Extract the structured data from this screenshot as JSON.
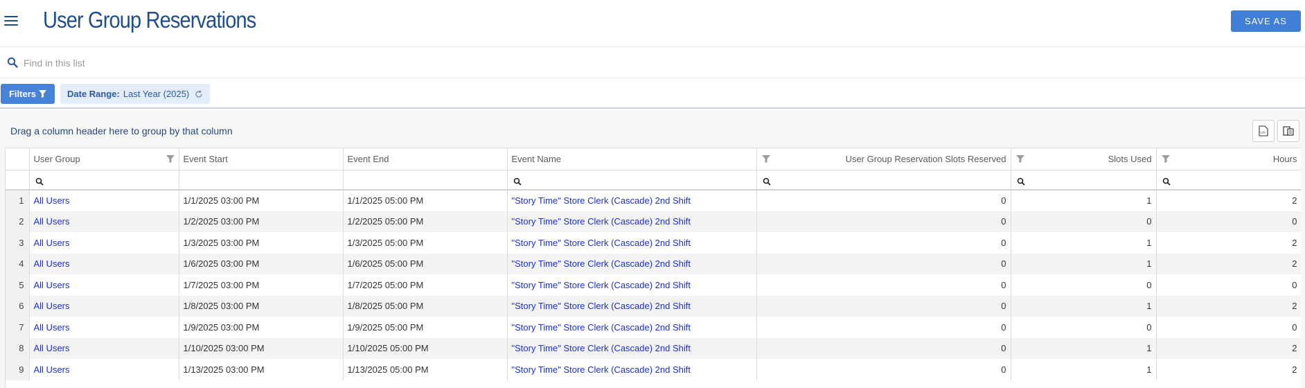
{
  "header": {
    "title": "User Group Reservations",
    "save_as_label": "SAVE AS"
  },
  "search": {
    "placeholder": "Find in this list"
  },
  "filters": {
    "button_label": "Filters",
    "chip_key": "Date Range:",
    "chip_value": "Last Year (2025)"
  },
  "grid": {
    "group_hint": "Drag a column header here to group by that column",
    "columns": [
      "User Group",
      "Event Start",
      "Event End",
      "Event Name",
      "User Group Reservation Slots Reserved",
      "Slots Used",
      "Hours"
    ],
    "rows": [
      {
        "n": "1",
        "user_group": "All Users",
        "start": "1/1/2025 03:00 PM",
        "end": "1/1/2025 05:00 PM",
        "event": "\"Story Time\" Store Clerk (Cascade) 2nd Shift",
        "reserved": "0",
        "used": "1",
        "hours": "2"
      },
      {
        "n": "2",
        "user_group": "All Users",
        "start": "1/2/2025 03:00 PM",
        "end": "1/2/2025 05:00 PM",
        "event": "\"Story Time\" Store Clerk (Cascade) 2nd Shift",
        "reserved": "0",
        "used": "0",
        "hours": "0"
      },
      {
        "n": "3",
        "user_group": "All Users",
        "start": "1/3/2025 03:00 PM",
        "end": "1/3/2025 05:00 PM",
        "event": "\"Story Time\" Store Clerk (Cascade) 2nd Shift",
        "reserved": "0",
        "used": "1",
        "hours": "2"
      },
      {
        "n": "4",
        "user_group": "All Users",
        "start": "1/6/2025 03:00 PM",
        "end": "1/6/2025 05:00 PM",
        "event": "\"Story Time\" Store Clerk (Cascade) 2nd Shift",
        "reserved": "0",
        "used": "1",
        "hours": "2"
      },
      {
        "n": "5",
        "user_group": "All Users",
        "start": "1/7/2025 03:00 PM",
        "end": "1/7/2025 05:00 PM",
        "event": "\"Story Time\" Store Clerk (Cascade) 2nd Shift",
        "reserved": "0",
        "used": "0",
        "hours": "0"
      },
      {
        "n": "6",
        "user_group": "All Users",
        "start": "1/8/2025 03:00 PM",
        "end": "1/8/2025 05:00 PM",
        "event": "\"Story Time\" Store Clerk (Cascade) 2nd Shift",
        "reserved": "0",
        "used": "1",
        "hours": "2"
      },
      {
        "n": "7",
        "user_group": "All Users",
        "start": "1/9/2025 03:00 PM",
        "end": "1/9/2025 05:00 PM",
        "event": "\"Story Time\" Store Clerk (Cascade) 2nd Shift",
        "reserved": "0",
        "used": "0",
        "hours": "0"
      },
      {
        "n": "8",
        "user_group": "All Users",
        "start": "1/10/2025 03:00 PM",
        "end": "1/10/2025 05:00 PM",
        "event": "\"Story Time\" Store Clerk (Cascade) 2nd Shift",
        "reserved": "0",
        "used": "1",
        "hours": "2"
      },
      {
        "n": "9",
        "user_group": "All Users",
        "start": "1/13/2025 03:00 PM",
        "end": "1/13/2025 05:00 PM",
        "event": "\"Story Time\" Store Clerk (Cascade) 2nd Shift",
        "reserved": "0",
        "used": "1",
        "hours": "2"
      }
    ]
  },
  "colors": {
    "title": "#1f4f8e",
    "primary_button": "#3f7fd5",
    "link": "#1a2fd0",
    "chip_bg": "#e3ecf8"
  },
  "icons": {
    "menu": "hamburger-menu-icon",
    "search": "search-icon",
    "filter": "funnel-icon",
    "reset": "refresh-icon",
    "export_csv": "csv-export-icon",
    "columns": "column-chooser-icon"
  }
}
